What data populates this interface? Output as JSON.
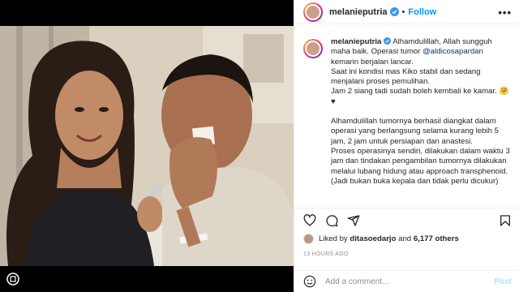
{
  "post": {
    "username": "melanieputria",
    "follow_label": "Follow",
    "more_label": "•••",
    "caption_lines": [
      "Alhamdulillah, Allah sungguh maha baik. Operasi tumor",
      "kemarin berjalan lancar.",
      "Saat ini kondisi mas Kiko stabil dan sedang menjalani proses pemulihan.",
      "Jam 2 siang tadi sudah boleh kembali ke kamar. 🤗",
      "♥",
      "Alhamdulillah tumornya berhasil diangkat dalam operasi yang berlangsung selama kurang lebih 5 jam, 2 jam untuk persiapan dan anastesi.",
      "Proses operasinya sendiri, dilakukan dalam waktu 3 jam dan tindakan pengambilan tumornya dilakukan melalui lubang hidung atau approach transphenoid. (Jadi bukan buka kepala dan tidak perlu dicukur)"
    ],
    "mention": "@aldicosapardan",
    "liked_by_prefix": "Liked by",
    "liked_by_user": "ditasoedarjo",
    "liked_by_and": "and",
    "liked_by_others": "6,177 others",
    "timestamp": "13 HOURS AGO",
    "comment_placeholder": "Add a comment...",
    "post_label": "Post"
  },
  "icons": {
    "verified": "verified-badge-icon",
    "heart": "heart-icon",
    "comment": "comment-icon",
    "share": "share-icon",
    "save": "bookmark-icon",
    "emoji": "emoji-icon",
    "reel": "reel-icon"
  },
  "colors": {
    "accent": "#0095f6",
    "verified": "#3897f0",
    "mention": "#00376b",
    "muted": "#8e8e8e"
  }
}
